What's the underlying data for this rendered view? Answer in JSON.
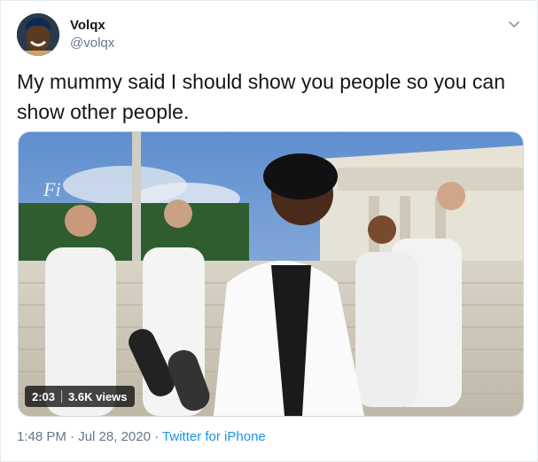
{
  "tweet": {
    "display_name": "Volqx",
    "handle": "@volqx",
    "text": "My mummy said I should show you people so you can show other people.",
    "video": {
      "duration": "2:03",
      "views": "3.6K views"
    },
    "time": "1:48 PM",
    "separator_1": "·",
    "date": "Jul 28, 2020",
    "separator_2": "·",
    "source": "Twitter for iPhone"
  }
}
